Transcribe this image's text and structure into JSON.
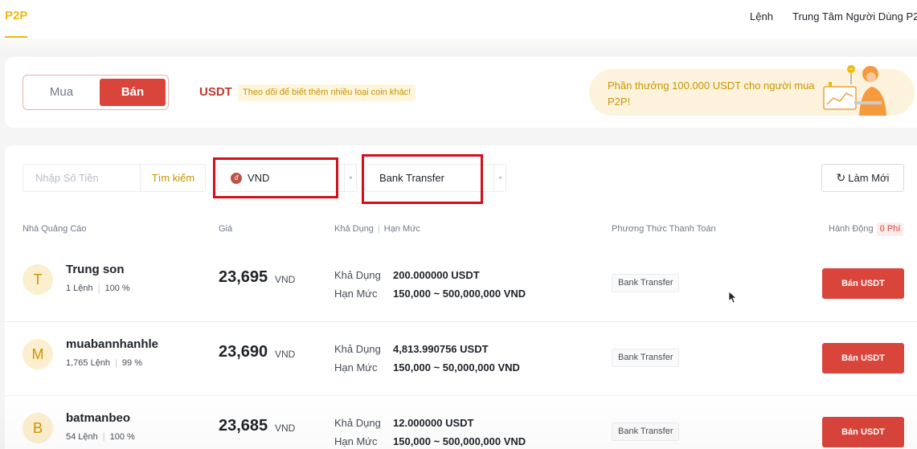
{
  "header": {
    "brand": "P2P",
    "nav_orders": "Lệnh",
    "nav_center": "Trung Tâm Người Dùng P2"
  },
  "promo": {
    "buy_label": "Mua",
    "sell_label": "Bán",
    "coin": "USDT",
    "coin_hint": "Theo dõi để biết thêm nhiều loại coin khác!",
    "reward_text": "Phần thưởng 100.000 USDT cho người mua P2P!"
  },
  "filters": {
    "amount_placeholder": "Nhập Số Tiền",
    "search_label": "Tìm kiếm",
    "currency": "VND",
    "currency_icon": "đ",
    "payment": "Bank Transfer",
    "refresh_label": "Làm Mới"
  },
  "table": {
    "col_advertiser": "Nhà Quảng Cáo",
    "col_price": "Giá",
    "col_available": "Khả Dụng",
    "col_limit": "Hạn Mức",
    "col_payment": "Phương Thức Thanh Toán",
    "col_action": "Hành Động",
    "fee_badge": "0 Phí",
    "available_label": "Khả Dụng",
    "limit_label": "Hạn Mức",
    "rows": [
      {
        "initial": "T",
        "name": "Trung son",
        "orders": "1 Lệnh",
        "completion": "100 %",
        "price": "23,695",
        "currency": "VND",
        "available": "200.000000 USDT",
        "limit": "150,000 ~ 500,000,000 VND",
        "payment": "Bank Transfer",
        "action": "Bán USDT"
      },
      {
        "initial": "M",
        "name": "muabannhanhle",
        "orders": "1,765 Lệnh",
        "completion": "99 %",
        "price": "23,690",
        "currency": "VND",
        "available": "4,813.990756 USDT",
        "limit": "150,000 ~ 50,000,000 VND",
        "payment": "Bank Transfer",
        "action": "Bán USDT"
      },
      {
        "initial": "B",
        "name": "batmanbeo",
        "orders": "54 Lệnh",
        "completion": "100 %",
        "price": "23,685",
        "currency": "VND",
        "available": "12.000000 USDT",
        "limit": "150,000 ~ 500,000,000 VND",
        "payment": "Bank Transfer",
        "action": "Bán USDT"
      }
    ]
  },
  "colors": {
    "brand": "#f0b90b",
    "sell": "#d9443b",
    "highlight": "#d0101a"
  }
}
